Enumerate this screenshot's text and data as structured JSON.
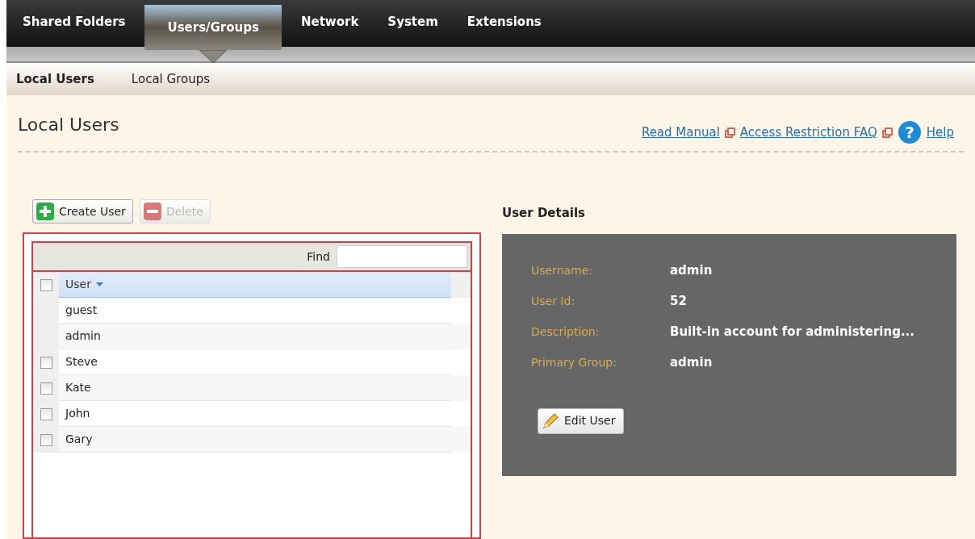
{
  "main_tabs": [
    {
      "label": "Shared Folders",
      "selected": false
    },
    {
      "label": "Users/Groups",
      "selected": true
    },
    {
      "label": "Network",
      "selected": false
    },
    {
      "label": "System",
      "selected": false
    },
    {
      "label": "Extensions",
      "selected": false
    }
  ],
  "sub_tabs": [
    {
      "label": "Local Users",
      "selected": true
    },
    {
      "label": "Local Groups",
      "selected": false
    }
  ],
  "page_title": "Local Users",
  "links": [
    {
      "label": "Read Manual",
      "kind": "external"
    },
    {
      "label": "Access Restriction FAQ",
      "kind": "external"
    },
    {
      "label": "Help",
      "kind": "help",
      "icon": "?"
    }
  ],
  "toolbar": [
    {
      "label": "Create User",
      "kind": "add",
      "disabled": false
    },
    {
      "label": "Delete",
      "kind": "remove",
      "disabled": true
    }
  ],
  "grid": {
    "find_label": "Find",
    "column": "User",
    "header_checked": false,
    "rows": [
      {
        "name": "guest",
        "kind": "plain"
      },
      {
        "name": "admin",
        "kind": "plain"
      },
      {
        "name": "Steve",
        "kind": "checkbox",
        "checked": false
      },
      {
        "name": "Kate",
        "kind": "checkbox",
        "checked": false
      },
      {
        "name": "John",
        "kind": "checkbox",
        "checked": false
      },
      {
        "name": "Gary",
        "kind": "checkbox",
        "checked": false
      }
    ]
  },
  "details": {
    "title": "User Details",
    "fields": [
      {
        "label": "Username:",
        "value": "admin"
      },
      {
        "label": "User Id:",
        "value": "52"
      },
      {
        "label": "Description:",
        "value": "Built-in account for administering..."
      },
      {
        "label": "Primary Group:",
        "value": "admin"
      }
    ],
    "edit_button": "Edit User"
  }
}
